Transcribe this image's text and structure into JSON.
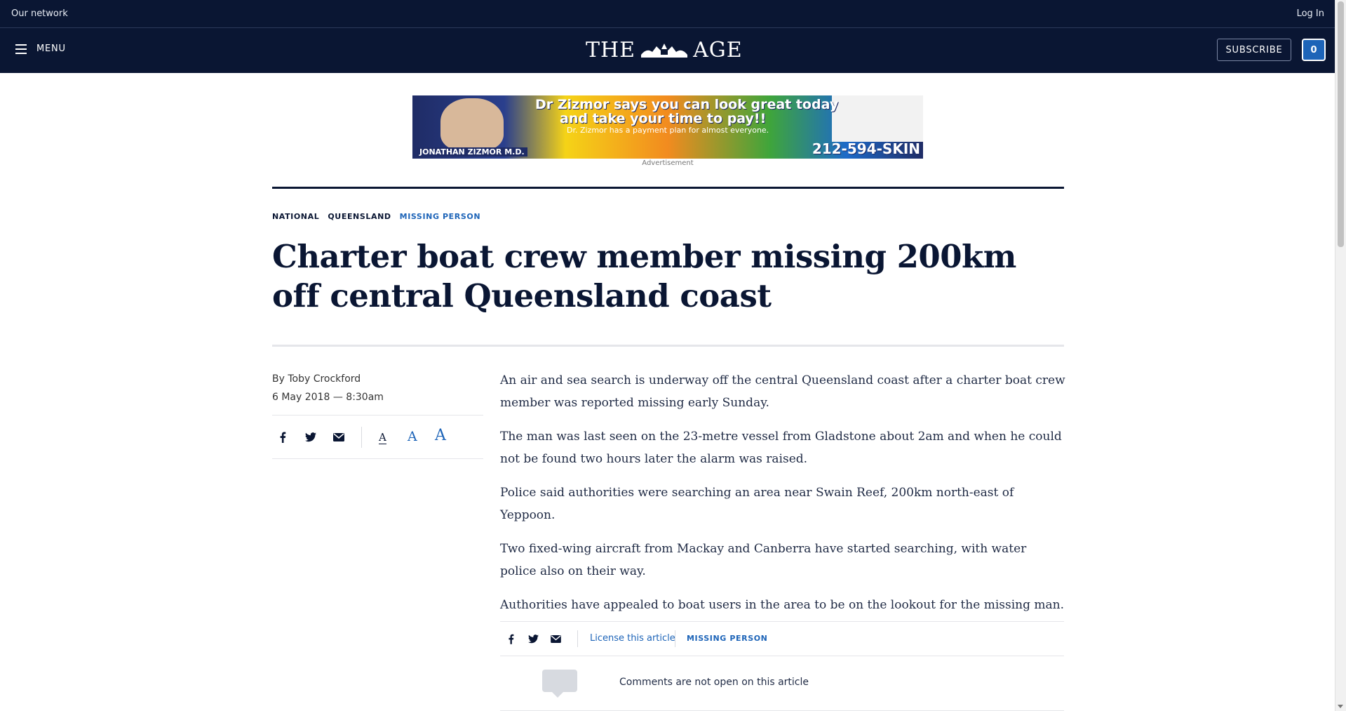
{
  "topbar": {
    "network": "Our network",
    "login": "Log In"
  },
  "header": {
    "menu_label": "MENU",
    "logo_left": "THE",
    "logo_right": "AGE",
    "subscribe": "SUBSCRIBE",
    "count": "0"
  },
  "ad": {
    "headline1": "Dr Zizmor says you can look great today",
    "headline2": "and take your time to pay!!",
    "subline": "Dr. Zizmor has a payment plan for almost everyone.",
    "name": "JONATHAN ZIZMOR M.D.",
    "phone": "212-594-SKIN",
    "label": "Advertisement"
  },
  "breadcrumbs": [
    "NATIONAL",
    "QUEENSLAND",
    "MISSING PERSON"
  ],
  "article": {
    "title": "Charter boat crew member missing 200km off central Queensland coast",
    "author": "By Toby Crockford",
    "date": "6 May 2018 — 8:30am",
    "paragraphs": [
      "An air and sea search is underway off the central Queensland coast after a charter boat crew member was reported missing early Sunday.",
      "The man was last seen on the 23-metre vessel from Gladstone about 2am and when he could not be found two hours later the alarm was raised.",
      "Police said authorities were searching an area near Swain Reef, 200km north-east of Yeppoon.",
      "Two fixed-wing aircraft from Mackay and Canberra have started searching, with water police also on their way.",
      "Authorities have appealed to boat users in the area to be on the lookout for the missing man."
    ]
  },
  "share": {
    "font_size_glyph": "A"
  },
  "footer": {
    "license": "License this article",
    "tag": "MISSING PERSON",
    "comments": "Comments are not open on this article"
  },
  "colors": {
    "navy": "#0a1633",
    "accent": "#1d64b8"
  }
}
